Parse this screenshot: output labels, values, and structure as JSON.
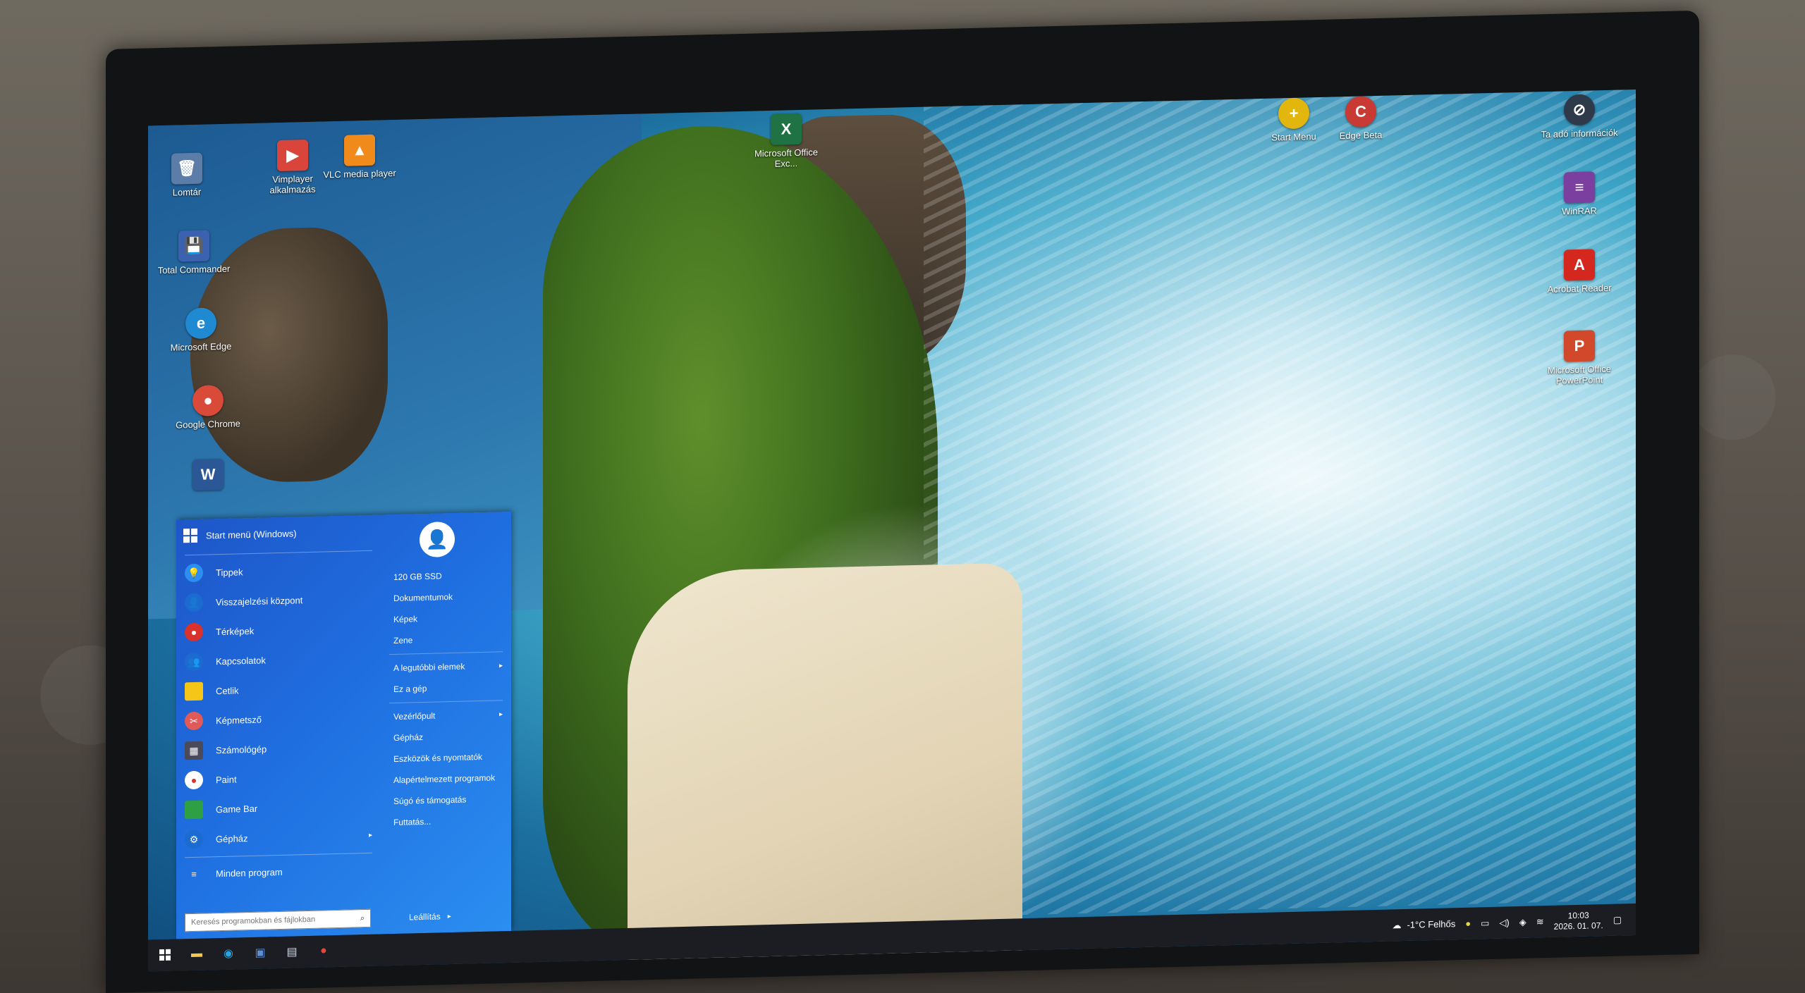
{
  "desktop": {
    "icons_left": [
      {
        "label": "Lomtár",
        "glyph": "🗑",
        "color": "#5b7da8"
      },
      {
        "label": "Total Commander",
        "glyph": "💾",
        "color": "#3b62b0"
      },
      {
        "label": "Microsoft Edge",
        "glyph": "e",
        "color": "#1f8ad1"
      },
      {
        "label": "Google Chrome",
        "glyph": "●",
        "color": "#d94a38"
      },
      {
        "label": "",
        "glyph": "W",
        "color": "#2b5797"
      }
    ],
    "icons_top": [
      {
        "label": "Vimplayer alkalmazás",
        "glyph": "▶",
        "color": "#d9453a"
      },
      {
        "label": "VLC media player",
        "glyph": "▲",
        "color": "#f08a1b"
      },
      {
        "label": "Microsoft Office Exc...",
        "glyph": "X",
        "color": "#1f7244"
      },
      {
        "label": "Start Menu",
        "glyph": "+",
        "color": "#e2b60c"
      },
      {
        "label": "Edge Beta",
        "glyph": "C",
        "color": "#c83a33"
      }
    ],
    "icons_right": [
      {
        "label": "Ta adó információk",
        "glyph": "⊘",
        "color": "#2e3a4a"
      },
      {
        "label": "WinRAR",
        "glyph": "≡",
        "color": "#7b3fa0"
      },
      {
        "label": "Acrobat Reader",
        "glyph": "A",
        "color": "#d4271e"
      },
      {
        "label": "Microsoft Office PowerPoint",
        "glyph": "P",
        "color": "#d2482a"
      }
    ]
  },
  "start_menu": {
    "header": "Start menü (Windows)",
    "items": [
      {
        "label": "Tippek",
        "icon": "lightbulb-icon",
        "glyph": "💡",
        "color": "#2b8ef0"
      },
      {
        "label": "Visszajelzési központ",
        "icon": "feedback-icon",
        "glyph": "👤",
        "color": "#1b6bd1"
      },
      {
        "label": "Térképek",
        "icon": "map-pin-icon",
        "glyph": "📍",
        "color": "#d9312b"
      },
      {
        "label": "Kapcsolatok",
        "icon": "people-icon",
        "glyph": "👥",
        "color": "#1b6bd1"
      },
      {
        "label": "Cetlik",
        "icon": "sticky-note-icon",
        "glyph": "▮",
        "color": "#f5c518"
      },
      {
        "label": "Képmetsző",
        "icon": "snip-icon",
        "glyph": "✂",
        "color": "#e05a5a"
      },
      {
        "label": "Számológép",
        "icon": "calculator-icon",
        "glyph": "▦",
        "color": "#4a4a5a"
      },
      {
        "label": "Paint",
        "icon": "paint-icon",
        "glyph": "🎨",
        "color": "#ffffff"
      },
      {
        "label": "Game Bar",
        "icon": "gamebar-icon",
        "glyph": "▬",
        "color": "#2ea043"
      },
      {
        "label": "Gépház",
        "icon": "gear-icon",
        "glyph": "⚙",
        "color": "#1b6bd1"
      }
    ],
    "all_programs": "Minden program",
    "search_placeholder": "Keresés programokban és fájlokban",
    "right": {
      "items_top": [
        "120 GB SSD",
        "Dokumentumok",
        "Képek",
        "Zene"
      ],
      "recent": "A legutóbbi elemek",
      "this_pc": "Ez a gép",
      "control_panel": "Vezérlőpult",
      "items_bottom": [
        "Gépház",
        "Eszközök és nyomtatók",
        "Alapértelmezett programok",
        "Súgó és támogatás",
        "Futtatás..."
      ]
    },
    "shutdown": "Leállítás"
  },
  "taskbar": {
    "apps": [
      "start-button",
      "file-explorer-icon",
      "edge-icon",
      "save-icon",
      "store-icon",
      "chrome-icon"
    ],
    "weather": "-1°C Felhős",
    "time": "10:03",
    "date": "2026. 01. 07."
  }
}
